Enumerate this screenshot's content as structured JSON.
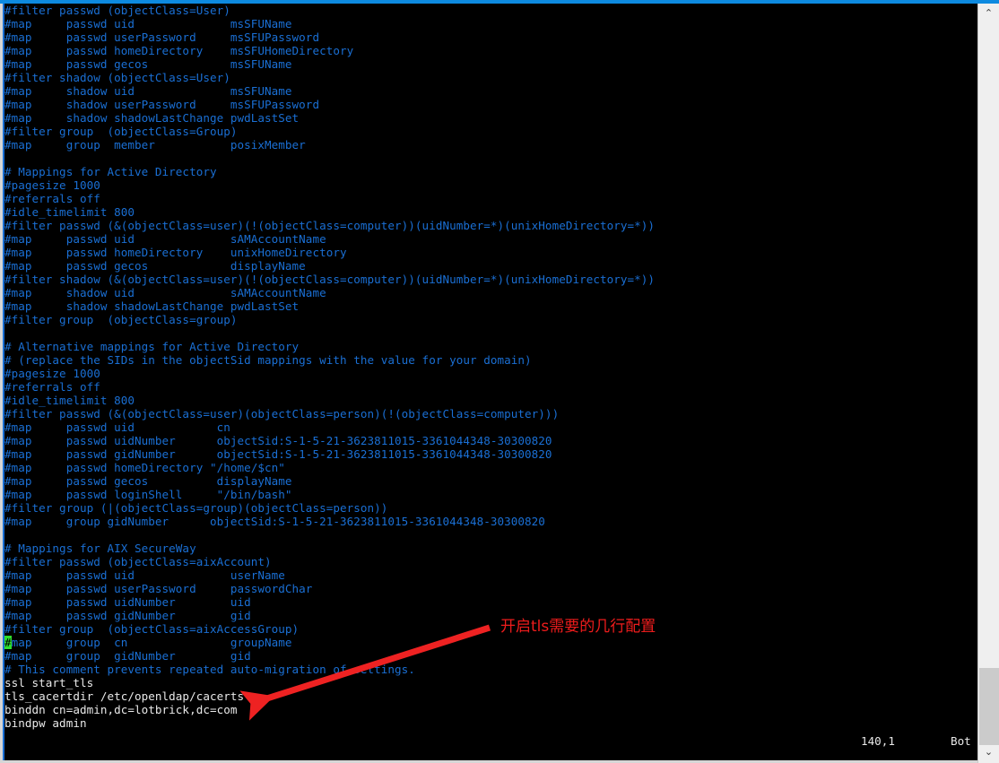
{
  "window": {
    "accent_color": "#0d8ae0",
    "background_color": "#000000",
    "comment_color": "#1a6fd4",
    "text_color": "#e9e9e9",
    "cursor_color": "#2ee02e",
    "annotation_color": "#ee1c1c"
  },
  "scrollbar": {
    "up_arrow": "⌃",
    "down_arrow": "⌄"
  },
  "statusline": {
    "position": "140,1",
    "scroll_state": "Bot"
  },
  "annotation": {
    "text": "开启tls需要的几行配置",
    "arrow_from": "545,700",
    "arrow_to": "272,787"
  },
  "cursor": {
    "line_index": 47,
    "column": 0,
    "char": "#"
  },
  "editor": {
    "lines": [
      {
        "t": "cmt",
        "s": "#filter passwd (objectClass=User)"
      },
      {
        "t": "cmt",
        "s": "#map     passwd uid              msSFUName"
      },
      {
        "t": "cmt",
        "s": "#map     passwd userPassword     msSFUPassword"
      },
      {
        "t": "cmt",
        "s": "#map     passwd homeDirectory    msSFUHomeDirectory"
      },
      {
        "t": "cmt",
        "s": "#map     passwd gecos            msSFUName"
      },
      {
        "t": "cmt",
        "s": "#filter shadow (objectClass=User)"
      },
      {
        "t": "cmt",
        "s": "#map     shadow uid              msSFUName"
      },
      {
        "t": "cmt",
        "s": "#map     shadow userPassword     msSFUPassword"
      },
      {
        "t": "cmt",
        "s": "#map     shadow shadowLastChange pwdLastSet"
      },
      {
        "t": "cmt",
        "s": "#filter group  (objectClass=Group)"
      },
      {
        "t": "cmt",
        "s": "#map     group  member           posixMember"
      },
      {
        "t": "blank",
        "s": ""
      },
      {
        "t": "cmt",
        "s": "# Mappings for Active Directory"
      },
      {
        "t": "cmt",
        "s": "#pagesize 1000"
      },
      {
        "t": "cmt",
        "s": "#referrals off"
      },
      {
        "t": "cmt",
        "s": "#idle_timelimit 800"
      },
      {
        "t": "cmt",
        "s": "#filter passwd (&(objectClass=user)(!(objectClass=computer))(uidNumber=*)(unixHomeDirectory=*))"
      },
      {
        "t": "cmt",
        "s": "#map     passwd uid              sAMAccountName"
      },
      {
        "t": "cmt",
        "s": "#map     passwd homeDirectory    unixHomeDirectory"
      },
      {
        "t": "cmt",
        "s": "#map     passwd gecos            displayName"
      },
      {
        "t": "cmt",
        "s": "#filter shadow (&(objectClass=user)(!(objectClass=computer))(uidNumber=*)(unixHomeDirectory=*))"
      },
      {
        "t": "cmt",
        "s": "#map     shadow uid              sAMAccountName"
      },
      {
        "t": "cmt",
        "s": "#map     shadow shadowLastChange pwdLastSet"
      },
      {
        "t": "cmt",
        "s": "#filter group  (objectClass=group)"
      },
      {
        "t": "blank",
        "s": ""
      },
      {
        "t": "cmt",
        "s": "# Alternative mappings for Active Directory"
      },
      {
        "t": "cmt",
        "s": "# (replace the SIDs in the objectSid mappings with the value for your domain)"
      },
      {
        "t": "cmt",
        "s": "#pagesize 1000"
      },
      {
        "t": "cmt",
        "s": "#referrals off"
      },
      {
        "t": "cmt",
        "s": "#idle_timelimit 800"
      },
      {
        "t": "cmt",
        "s": "#filter passwd (&(objectClass=user)(objectClass=person)(!(objectClass=computer)))"
      },
      {
        "t": "cmt",
        "s": "#map     passwd uid            cn"
      },
      {
        "t": "cmt",
        "s": "#map     passwd uidNumber      objectSid:S-1-5-21-3623811015-3361044348-30300820"
      },
      {
        "t": "cmt",
        "s": "#map     passwd gidNumber      objectSid:S-1-5-21-3623811015-3361044348-30300820"
      },
      {
        "t": "cmt",
        "s": "#map     passwd homeDirectory \"/home/$cn\""
      },
      {
        "t": "cmt",
        "s": "#map     passwd gecos          displayName"
      },
      {
        "t": "cmt",
        "s": "#map     passwd loginShell     \"/bin/bash\""
      },
      {
        "t": "cmt",
        "s": "#filter group (|(objectClass=group)(objectClass=person))"
      },
      {
        "t": "cmt",
        "s": "#map     group gidNumber      objectSid:S-1-5-21-3623811015-3361044348-30300820"
      },
      {
        "t": "blank",
        "s": ""
      },
      {
        "t": "cmt",
        "s": "# Mappings for AIX SecureWay"
      },
      {
        "t": "cmt",
        "s": "#filter passwd (objectClass=aixAccount)"
      },
      {
        "t": "cmt",
        "s": "#map     passwd uid              userName"
      },
      {
        "t": "cmt",
        "s": "#map     passwd userPassword     passwordChar"
      },
      {
        "t": "cmt",
        "s": "#map     passwd uidNumber        uid"
      },
      {
        "t": "cmt",
        "s": "#map     passwd gidNumber        gid"
      },
      {
        "t": "cmt",
        "s": "#filter group  (objectClass=aixAccessGroup)"
      },
      {
        "t": "cmt",
        "s": "#map     group  cn               groupName"
      },
      {
        "t": "cmt",
        "s": "#map     group  gidNumber        gid"
      },
      {
        "t": "cmt",
        "s": "# This comment prevents repeated auto-migration of settings."
      },
      {
        "t": "txt",
        "s": "ssl start_tls"
      },
      {
        "t": "txt",
        "s": "tls_cacertdir /etc/openldap/cacerts"
      },
      {
        "t": "txt",
        "s": "binddn cn=admin,dc=lotbrick,dc=com"
      },
      {
        "t": "txt",
        "s": "bindpw admin"
      }
    ]
  }
}
